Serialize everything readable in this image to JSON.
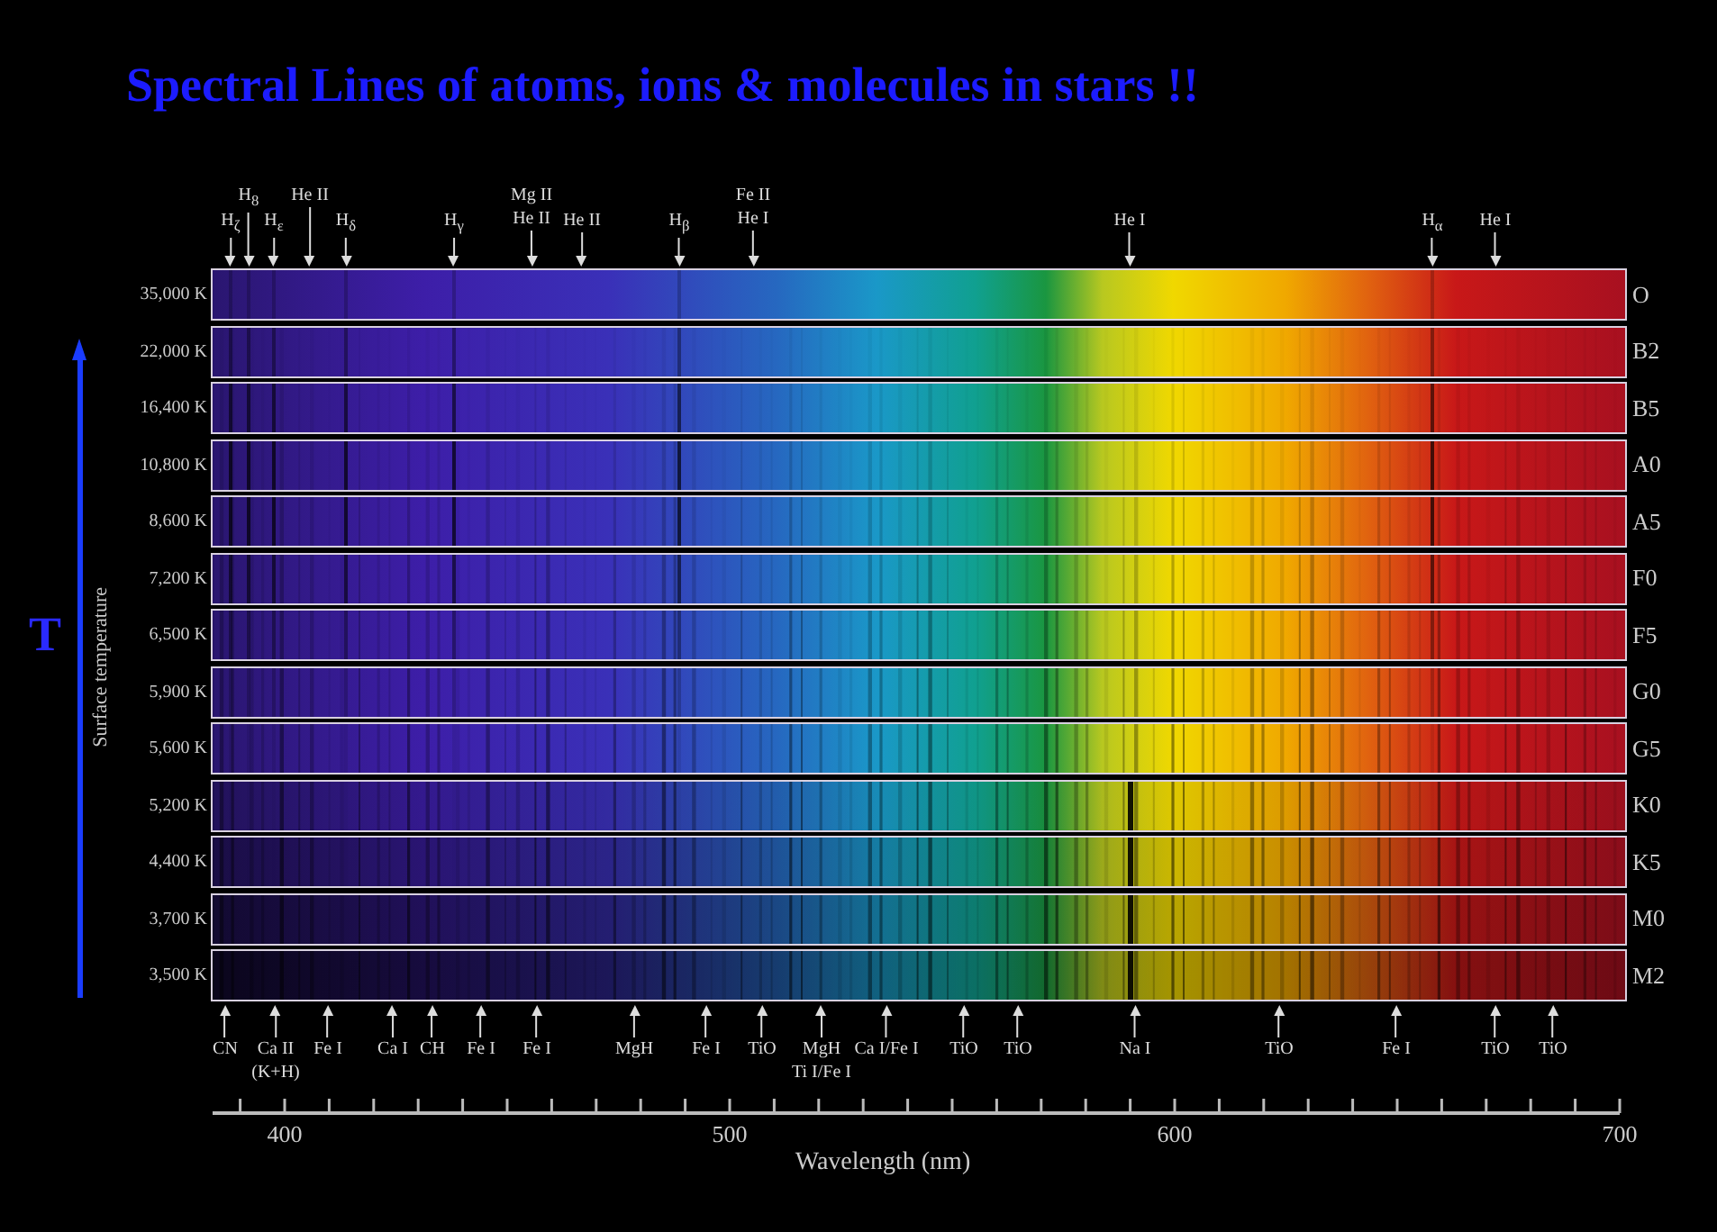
{
  "title": "Spectral Lines of atoms, ions & molecules in stars !!",
  "temperature_axis": {
    "symbol": "T",
    "label": "Surface temperature"
  },
  "top_lines": [
    {
      "label": [
        "H$_{ζ}$"
      ]
    },
    {
      "label": [
        "H$_{8}$"
      ]
    },
    {
      "label": [
        "H$_{ε}$"
      ]
    },
    {
      "label": [
        "He II"
      ]
    },
    {
      "label": [
        "H$_{δ}$"
      ]
    },
    {
      "label": [
        "H$_{γ}$"
      ]
    },
    {
      "label": [
        "Mg II",
        "He II"
      ]
    },
    {
      "label": [
        "He II"
      ]
    },
    {
      "label": [
        "H$_{β}$"
      ]
    },
    {
      "label": [
        "Fe II",
        "He I"
      ]
    },
    {
      "label": [
        "He I"
      ]
    },
    {
      "label": [
        "H$_{α}$"
      ]
    },
    {
      "label": [
        "He I"
      ]
    }
  ],
  "spectra": [
    {
      "temperature": "35,000 K",
      "class": "O"
    },
    {
      "temperature": "22,000 K",
      "class": "B2"
    },
    {
      "temperature": "16,400 K",
      "class": "B5"
    },
    {
      "temperature": "10,800 K",
      "class": "A0"
    },
    {
      "temperature": "8,600 K",
      "class": "A5"
    },
    {
      "temperature": "7,200 K",
      "class": "F0"
    },
    {
      "temperature": "6,500 K",
      "class": "F5"
    },
    {
      "temperature": "5,900 K",
      "class": "G0"
    },
    {
      "temperature": "5,600 K",
      "class": "G5"
    },
    {
      "temperature": "5,200 K",
      "class": "K0"
    },
    {
      "temperature": "4,400 K",
      "class": "K5"
    },
    {
      "temperature": "3,700 K",
      "class": "M0"
    },
    {
      "temperature": "3,500 K",
      "class": "M2"
    }
  ],
  "bottom_lines": [
    {
      "label": [
        "CN"
      ]
    },
    {
      "label": [
        "Ca II",
        "(K+H)"
      ]
    },
    {
      "label": [
        "Fe I"
      ]
    },
    {
      "label": [
        "Ca I"
      ]
    },
    {
      "label": [
        "CH"
      ]
    },
    {
      "label": [
        "Fe I"
      ]
    },
    {
      "label": [
        "Fe I"
      ]
    },
    {
      "label": [
        "MgH"
      ]
    },
    {
      "label": [
        "Fe I"
      ]
    },
    {
      "label": [
        "TiO"
      ]
    },
    {
      "label": [
        "MgH",
        "Ti I/Fe I"
      ]
    },
    {
      "label": [
        "Ca I/Fe I"
      ]
    },
    {
      "label": [
        "TiO"
      ]
    },
    {
      "label": [
        "TiO"
      ]
    },
    {
      "label": [
        "Na I"
      ]
    },
    {
      "label": [
        "TiO"
      ]
    },
    {
      "label": [
        "Fe I"
      ]
    },
    {
      "label": [
        "TiO"
      ]
    },
    {
      "label": [
        "TiO"
      ]
    }
  ],
  "wavelength_axis": {
    "tick_labels": [
      "400",
      "500",
      "600",
      "700"
    ],
    "title": "Wavelength (nm)"
  }
}
